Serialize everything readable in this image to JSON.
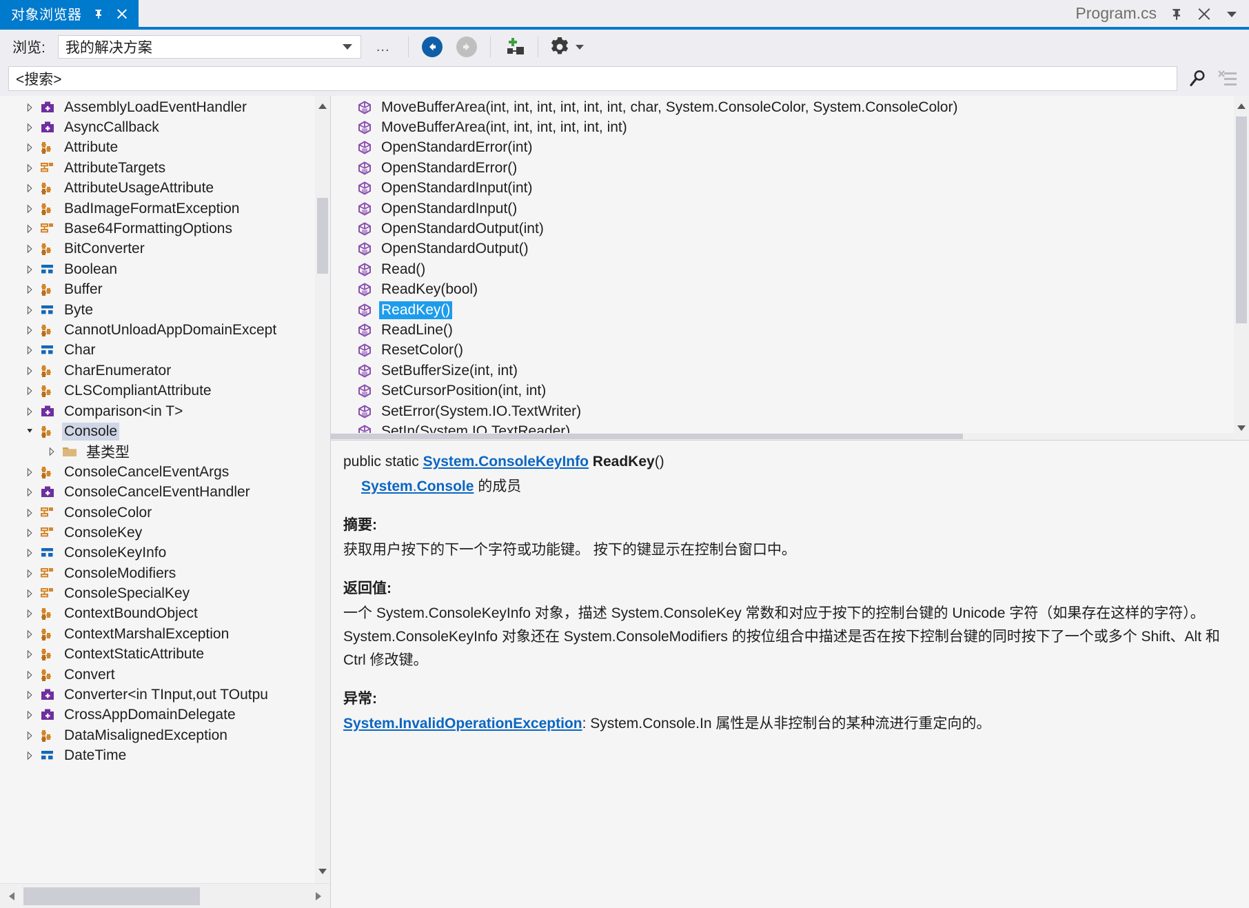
{
  "window": {
    "tab_title": "对象浏览器",
    "pin_icon": "pin-icon",
    "close_icon": "close-icon",
    "document_name": "Program.cs",
    "doc_pin_icon": "pin-icon",
    "doc_close_icon": "close-icon",
    "doc_menu_icon": "chevron-down-icon"
  },
  "toolbar": {
    "browse_label": "浏览:",
    "browse_value": "我的解决方案",
    "browse_caret_icon": "chevron-down-icon",
    "ellipsis_label": "...",
    "back_icon": "back-arrow-icon",
    "forward_icon": "forward-arrow-icon",
    "add_to_browse_icon": "add-namespace-icon",
    "settings_icon": "gear-icon",
    "settings_caret_icon": "chevron-down-icon"
  },
  "search": {
    "value": "<搜索>",
    "caret_icon": "chevron-down-icon",
    "search_icon": "search-icon",
    "clear_search_icon": "clear-search-icon"
  },
  "tree": {
    "nodes": [
      {
        "label": "AssemblyLoadEventHandler",
        "icon": "delegate-icon",
        "depth": 1,
        "state": "collapsed"
      },
      {
        "label": "AsyncCallback",
        "icon": "delegate-icon",
        "depth": 1,
        "state": "collapsed"
      },
      {
        "label": "Attribute",
        "icon": "class-icon",
        "depth": 1,
        "state": "collapsed"
      },
      {
        "label": "AttributeTargets",
        "icon": "enum-icon",
        "depth": 1,
        "state": "collapsed"
      },
      {
        "label": "AttributeUsageAttribute",
        "icon": "class-icon",
        "depth": 1,
        "state": "collapsed"
      },
      {
        "label": "BadImageFormatException",
        "icon": "class-icon",
        "depth": 1,
        "state": "collapsed"
      },
      {
        "label": "Base64FormattingOptions",
        "icon": "enum-icon",
        "depth": 1,
        "state": "collapsed"
      },
      {
        "label": "BitConverter",
        "icon": "class-icon",
        "depth": 1,
        "state": "collapsed"
      },
      {
        "label": "Boolean",
        "icon": "struct-icon",
        "depth": 1,
        "state": "collapsed"
      },
      {
        "label": "Buffer",
        "icon": "class-icon",
        "depth": 1,
        "state": "collapsed"
      },
      {
        "label": "Byte",
        "icon": "struct-icon",
        "depth": 1,
        "state": "collapsed"
      },
      {
        "label": "CannotUnloadAppDomainExcept",
        "icon": "class-icon",
        "depth": 1,
        "state": "collapsed"
      },
      {
        "label": "Char",
        "icon": "struct-icon",
        "depth": 1,
        "state": "collapsed"
      },
      {
        "label": "CharEnumerator",
        "icon": "class-icon",
        "depth": 1,
        "state": "collapsed"
      },
      {
        "label": "CLSCompliantAttribute",
        "icon": "class-icon",
        "depth": 1,
        "state": "collapsed"
      },
      {
        "label": "Comparison<in T>",
        "icon": "delegate-icon",
        "depth": 1,
        "state": "collapsed"
      },
      {
        "label": "Console",
        "icon": "class-icon",
        "depth": 1,
        "state": "expanded",
        "selected": true
      },
      {
        "label": "基类型",
        "icon": "folder-icon",
        "depth": 2,
        "state": "collapsed"
      },
      {
        "label": "ConsoleCancelEventArgs",
        "icon": "class-icon",
        "depth": 1,
        "state": "collapsed"
      },
      {
        "label": "ConsoleCancelEventHandler",
        "icon": "delegate-icon",
        "depth": 1,
        "state": "collapsed"
      },
      {
        "label": "ConsoleColor",
        "icon": "enum-icon",
        "depth": 1,
        "state": "collapsed"
      },
      {
        "label": "ConsoleKey",
        "icon": "enum-icon",
        "depth": 1,
        "state": "collapsed"
      },
      {
        "label": "ConsoleKeyInfo",
        "icon": "struct-icon",
        "depth": 1,
        "state": "collapsed"
      },
      {
        "label": "ConsoleModifiers",
        "icon": "enum-icon",
        "depth": 1,
        "state": "collapsed"
      },
      {
        "label": "ConsoleSpecialKey",
        "icon": "enum-icon",
        "depth": 1,
        "state": "collapsed"
      },
      {
        "label": "ContextBoundObject",
        "icon": "class-icon",
        "depth": 1,
        "state": "collapsed"
      },
      {
        "label": "ContextMarshalException",
        "icon": "class-icon",
        "depth": 1,
        "state": "collapsed"
      },
      {
        "label": "ContextStaticAttribute",
        "icon": "class-icon",
        "depth": 1,
        "state": "collapsed"
      },
      {
        "label": "Convert",
        "icon": "class-icon",
        "depth": 1,
        "state": "collapsed"
      },
      {
        "label": "Converter<in TInput,out TOutpu",
        "icon": "delegate-icon",
        "depth": 1,
        "state": "collapsed"
      },
      {
        "label": "CrossAppDomainDelegate",
        "icon": "delegate-icon",
        "depth": 1,
        "state": "collapsed"
      },
      {
        "label": "DataMisalignedException",
        "icon": "class-icon",
        "depth": 1,
        "state": "collapsed"
      },
      {
        "label": "DateTime",
        "icon": "struct-icon",
        "depth": 1,
        "state": "collapsed"
      }
    ],
    "scroll_up_icon": "scroll-up-icon",
    "scroll_down_icon": "scroll-down-icon",
    "hscroll_left_icon": "scroll-left-icon",
    "hscroll_right_icon": "scroll-right-icon"
  },
  "members": {
    "items": [
      {
        "label": "MoveBufferArea(int, int, int, int, int, int, char, System.ConsoleColor, System.ConsoleColor)",
        "icon": "method-icon"
      },
      {
        "label": "MoveBufferArea(int, int, int, int, int, int)",
        "icon": "method-icon"
      },
      {
        "label": "OpenStandardError(int)",
        "icon": "method-icon"
      },
      {
        "label": "OpenStandardError()",
        "icon": "method-icon"
      },
      {
        "label": "OpenStandardInput(int)",
        "icon": "method-icon"
      },
      {
        "label": "OpenStandardInput()",
        "icon": "method-icon"
      },
      {
        "label": "OpenStandardOutput(int)",
        "icon": "method-icon"
      },
      {
        "label": "OpenStandardOutput()",
        "icon": "method-icon"
      },
      {
        "label": "Read()",
        "icon": "method-icon"
      },
      {
        "label": "ReadKey(bool)",
        "icon": "method-icon"
      },
      {
        "label": "ReadKey()",
        "icon": "method-icon",
        "selected": true
      },
      {
        "label": "ReadLine()",
        "icon": "method-icon"
      },
      {
        "label": "ResetColor()",
        "icon": "method-icon"
      },
      {
        "label": "SetBufferSize(int, int)",
        "icon": "method-icon"
      },
      {
        "label": "SetCursorPosition(int, int)",
        "icon": "method-icon"
      },
      {
        "label": "SetError(System.IO.TextWriter)",
        "icon": "method-icon"
      },
      {
        "label": "SetIn(System.IO.TextReader)",
        "icon": "method-icon"
      }
    ],
    "scroll_up_icon": "scroll-up-icon",
    "scroll_down_icon": "scroll-down-icon"
  },
  "description": {
    "signature_prefix": "public static ",
    "signature_type_link": "System.ConsoleKeyInfo",
    "signature_name": " ReadKey",
    "signature_suffix": "()",
    "member_of_link_1": "System",
    "member_of_dot": ".",
    "member_of_link_2": "Console",
    "member_of_text": " 的成员",
    "summary_heading": "摘要:",
    "summary_text": "获取用户按下的下一个字符或功能键。 按下的键显示在控制台窗口中。",
    "returns_heading": "返回值:",
    "returns_text": "一个 System.ConsoleKeyInfo 对象，描述 System.ConsoleKey 常数和对应于按下的控制台键的 Unicode 字符（如果存在这样的字符）。 System.ConsoleKeyInfo 对象还在 System.ConsoleModifiers 的按位组合中描述是否在按下控制台键的同时按下了一个或多个 Shift、Alt 和 Ctrl 修改键。",
    "exceptions_heading": "异常:",
    "exception_link": "System.InvalidOperationException",
    "exception_text": ": System.Console.In 属性是从非控制台的某种流进行重定向的。"
  },
  "colors": {
    "accent_blue": "#007acc",
    "selection_blue": "#1e9cec",
    "tree_selection": "#cfd6e6",
    "link_blue": "#0b66c3",
    "class_orange": "#d4862a",
    "enum_orange": "#d4862a",
    "struct_blue": "#1667b5",
    "delegate_purple": "#6f2f9f",
    "method_purple": "#8a4fb0",
    "folder_tan": "#dcb67a"
  }
}
